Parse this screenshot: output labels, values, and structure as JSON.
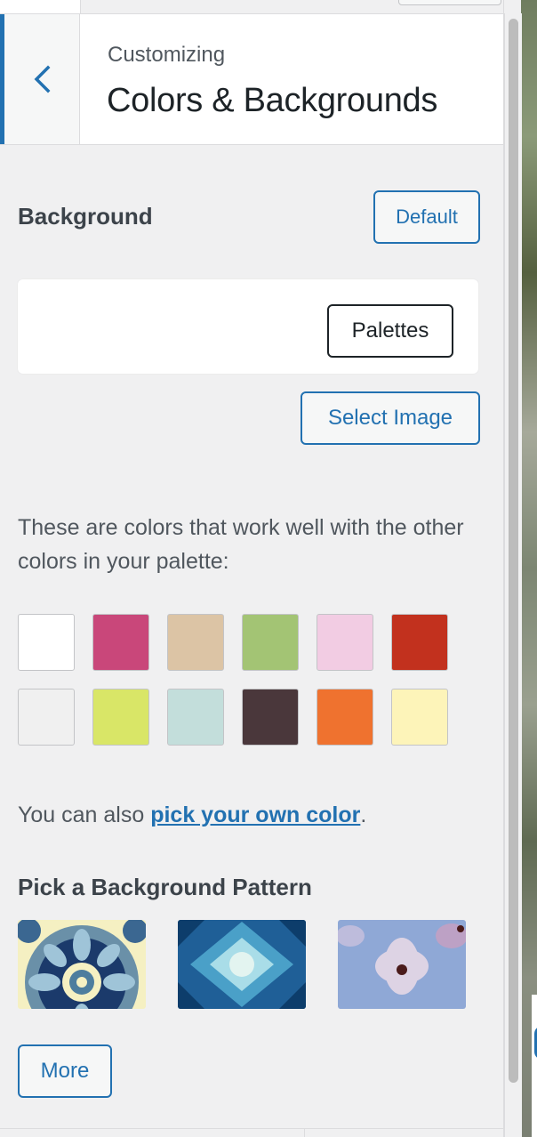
{
  "header": {
    "overline": "Customizing",
    "title": "Colors & Backgrounds"
  },
  "background": {
    "section_label": "Background",
    "default_button": "Default",
    "palettes_button": "Palettes",
    "select_image_button": "Select Image"
  },
  "palette_description": "These are colors that work well with the other colors in your palette:",
  "swatches": [
    {
      "color": "#ffffff"
    },
    {
      "color": "#c9477a"
    },
    {
      "color": "#dcc4a5"
    },
    {
      "color": "#a3c474"
    },
    {
      "color": "#f2cce3"
    },
    {
      "color": "#c2311e"
    },
    {
      "color": "#f0f0f0"
    },
    {
      "color": "#d9e667"
    },
    {
      "color": "#c3dedb"
    },
    {
      "color": "#4a373b"
    },
    {
      "color": "#ef722f"
    },
    {
      "color": "#fdf4b9"
    }
  ],
  "custom_color": {
    "prefix": "You can also ",
    "link": "pick your own color",
    "suffix": "."
  },
  "patterns": {
    "title": "Pick a Background Pattern",
    "items": [
      {
        "icon": "mandala-pattern-thumbnail"
      },
      {
        "icon": "kaleidoscope-pattern-thumbnail"
      },
      {
        "icon": "flower-pattern-thumbnail"
      }
    ],
    "more_button": "More"
  },
  "colors": {
    "accent": "#2271b1",
    "panel_bg": "#f0f0f1",
    "text": "#50575e"
  }
}
